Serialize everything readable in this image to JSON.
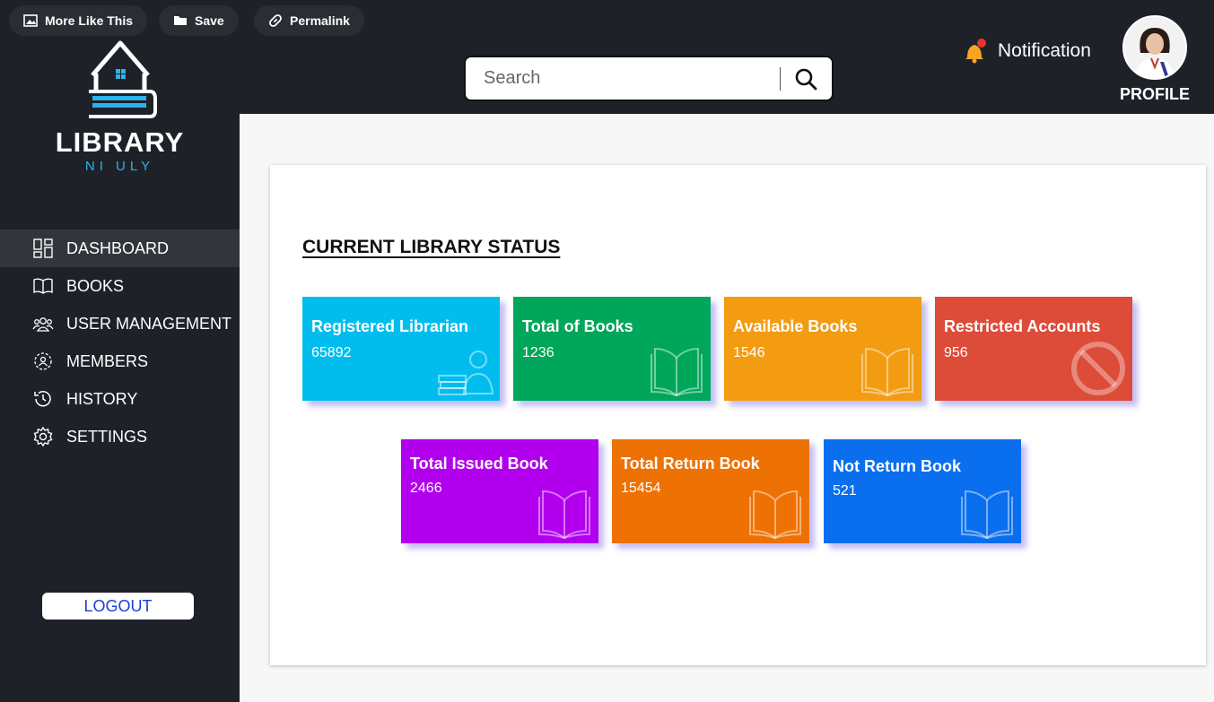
{
  "topbar": {
    "more_like_this": "More Like This",
    "save": "Save",
    "permalink": "Permalink"
  },
  "logo": {
    "name": "LIBRARY",
    "sub": "NI ULY"
  },
  "nav": [
    {
      "label": "DASHBOARD",
      "icon": "dashboard-icon",
      "active": true
    },
    {
      "label": "BOOKS",
      "icon": "book-icon"
    },
    {
      "label": "USER MANAGEMENT",
      "icon": "users-icon"
    },
    {
      "label": "MEMBERS",
      "icon": "members-icon"
    },
    {
      "label": "HISTORY",
      "icon": "history-icon"
    },
    {
      "label": "SETTINGS",
      "icon": "gear-icon"
    }
  ],
  "logout": "LOGOUT",
  "search": {
    "placeholder": "Search"
  },
  "notification": "Notification",
  "profile": "PROFILE",
  "section_title": "CURRENT LIBRARY STATUS",
  "cards": [
    {
      "title": "Registered Librarian",
      "value": "65892",
      "color": "#00bdee",
      "icon": "librarian-icon"
    },
    {
      "title": "Total of Books",
      "value": "1236",
      "color": "#00a65a",
      "icon": "open-book-icon"
    },
    {
      "title": "Available Books",
      "value": "1546",
      "color": "#f39c12",
      "icon": "open-book-icon"
    },
    {
      "title": "Restricted Accounts",
      "value": "956",
      "color": "#dd4b39",
      "icon": "restricted-icon"
    },
    {
      "title": "Total Issued Book",
      "value": "2466",
      "color": "#b200ee",
      "icon": "open-book-icon"
    },
    {
      "title": "Total Return Book",
      "value": "15454",
      "color": "#ee7103",
      "icon": "open-book-icon"
    },
    {
      "title": "Not Return Book",
      "value": "521",
      "color": "#0a6fee",
      "icon": "open-book-icon"
    }
  ]
}
